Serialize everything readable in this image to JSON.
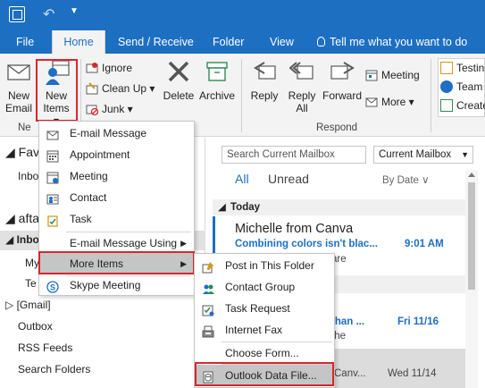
{
  "ribbon_tabs": [
    "File",
    "Home",
    "Send / Receive",
    "Folder",
    "View"
  ],
  "tell_me": "Tell me what you want to do",
  "ribbon": {
    "new_email": [
      "New",
      "Email"
    ],
    "new_items": [
      "New",
      "Items ▾"
    ],
    "new_group_label": "Ne",
    "ignore": "Ignore",
    "clean_up": "Clean Up ▾",
    "junk": "Junk ▾",
    "delete": "Delete",
    "archive": "Archive",
    "reply": "Reply",
    "reply_all": [
      "Reply",
      "All"
    ],
    "forward": "Forward",
    "meeting": "Meeting",
    "more": "More ▾",
    "respond_label": "Respond",
    "quick_steps": [
      "Testin",
      "Team",
      "Create"
    ]
  },
  "folder_pane": {
    "favorites": "Fave",
    "inbox_fav": "Inbo",
    "account": "afta",
    "inbox": "Inbo",
    "my": "My",
    "te": "Te",
    "gmail": "[Gmail]",
    "outbox": "Outbox",
    "rss": "RSS Feeds",
    "search_folders": "Search Folders"
  },
  "message_list": {
    "search_placeholder": "Search Current Mailbox",
    "scope": "Current Mailbox",
    "filter_all": "All",
    "filter_unread": "Unread",
    "sort": "By Date ∨",
    "group_today": "Today",
    "msg1_sender": "Michelle from Canva",
    "msg1_subject": "Combining colors isn't blac...",
    "msg1_time": "9:01 AM",
    "msg1_preview": "are",
    "msg2_subject_tail": "than ...",
    "msg2_time": "Fri 11/16",
    "msg2_preview": "the",
    "msg3_preview": "Canv...",
    "msg3_time": "Wed 11/14"
  },
  "new_items_menu": [
    {
      "label": "E-mail Message",
      "icon": "email-icon"
    },
    {
      "label": "Appointment",
      "icon": "calendar-icon"
    },
    {
      "label": "Meeting",
      "icon": "meeting-icon"
    },
    {
      "label": "Contact",
      "icon": "contact-card-icon"
    },
    {
      "label": "Task",
      "icon": "task-clipboard-icon"
    },
    {
      "label": "E-mail Message Using",
      "icon": ""
    },
    {
      "label": "More Items",
      "icon": ""
    },
    {
      "label": "Skype Meeting",
      "icon": "skype-icon"
    }
  ],
  "more_items_menu": [
    {
      "label": "Post in This Folder",
      "icon": "post-icon"
    },
    {
      "label": "Contact Group",
      "icon": "contact-group-icon"
    },
    {
      "label": "Task Request",
      "icon": "task-request-icon"
    },
    {
      "label": "Internet Fax",
      "icon": "fax-icon"
    },
    {
      "label": "Choose Form...",
      "icon": "form-icon"
    },
    {
      "label": "Outlook Data File...",
      "icon": "data-file-icon"
    }
  ],
  "colors": {
    "accent": "#1d6fc2",
    "highlight_box": "#d8262d",
    "menu_hover": "#c5c5c5"
  }
}
